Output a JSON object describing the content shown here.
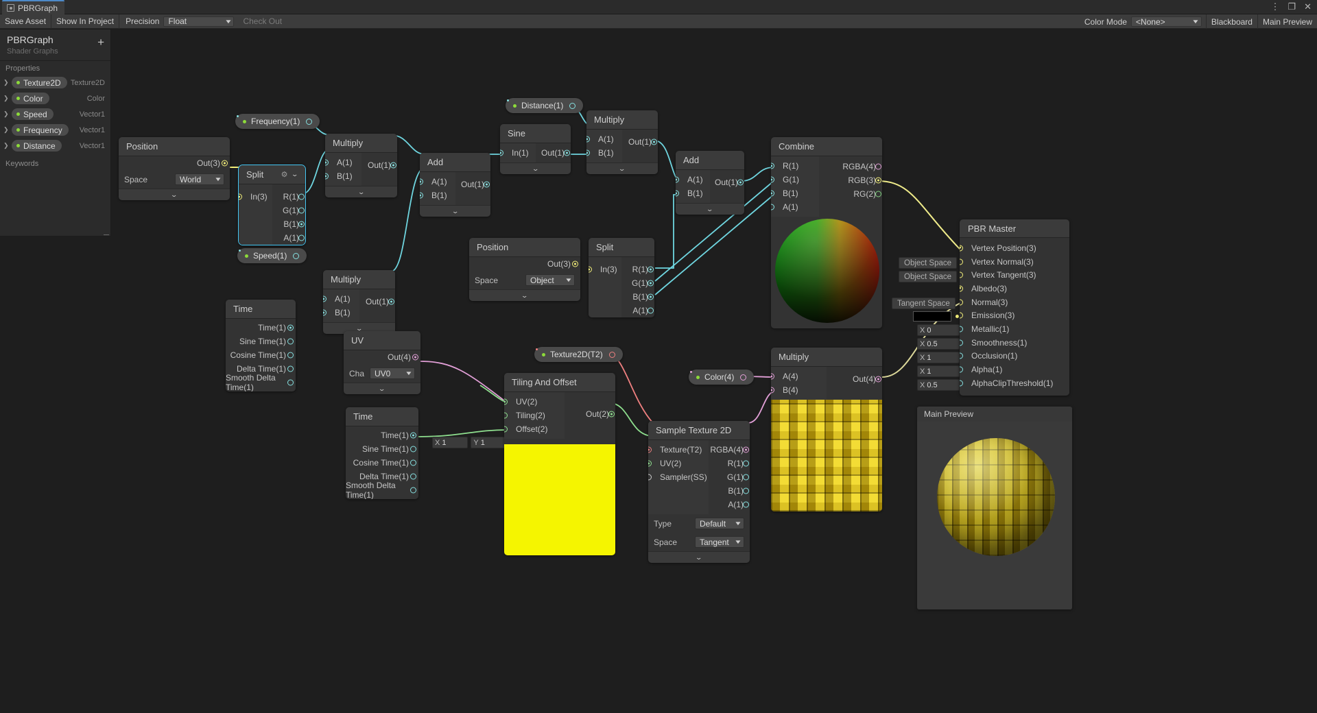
{
  "window": {
    "tab_title": "PBRGraph",
    "controls": [
      "⋮",
      "❐",
      "✕"
    ]
  },
  "toolbar": {
    "save_asset": "Save Asset",
    "show_in_project": "Show In Project",
    "precision_label": "Precision",
    "precision_value": "Float",
    "check_out": "Check Out",
    "color_mode_label": "Color Mode",
    "color_mode_value": "<None>",
    "blackboard": "Blackboard",
    "main_preview": "Main Preview"
  },
  "blackboard": {
    "title": "PBRGraph",
    "subtitle": "Shader Graphs",
    "properties_header": "Properties",
    "keywords_header": "Keywords",
    "add_label": "+",
    "properties": [
      {
        "name": "Texture2D",
        "type": "Texture2D"
      },
      {
        "name": "Color",
        "type": "Color"
      },
      {
        "name": "Speed",
        "type": "Vector1"
      },
      {
        "name": "Frequency",
        "type": "Vector1"
      },
      {
        "name": "Distance",
        "type": "Vector1"
      }
    ]
  },
  "tokens": {
    "frequency": "Frequency(1)",
    "distance": "Distance(1)",
    "speed": "Speed(1)",
    "texture2d": "Texture2D(T2)",
    "color": "Color(4)"
  },
  "nodes": {
    "position_world": {
      "title": "Position",
      "out": "Out(3)",
      "space_label": "Space",
      "space_value": "World"
    },
    "split_top": {
      "title": "Split",
      "in": "In(3)",
      "outputs": [
        "R(1)",
        "G(1)",
        "B(1)",
        "A(1)"
      ]
    },
    "multiply_1": {
      "title": "Multiply",
      "a": "A(1)",
      "b": "B(1)",
      "out": "Out(1)"
    },
    "add_1": {
      "title": "Add",
      "a": "A(1)",
      "b": "B(1)",
      "out": "Out(1)"
    },
    "sine": {
      "title": "Sine",
      "in": "In(1)",
      "out": "Out(1)"
    },
    "multiply_2": {
      "title": "Multiply",
      "a": "A(1)",
      "b": "B(1)",
      "out": "Out(1)"
    },
    "add_2": {
      "title": "Add",
      "a": "A(1)",
      "b": "B(1)",
      "out": "Out(1)"
    },
    "multiply_3": {
      "title": "Multiply",
      "a": "A(1)",
      "b": "B(1)",
      "out": "Out(1)"
    },
    "time_top": {
      "title": "Time",
      "outputs": [
        "Time(1)",
        "Sine Time(1)",
        "Cosine Time(1)",
        "Delta Time(1)",
        "Smooth Delta Time(1)"
      ]
    },
    "position_object": {
      "title": "Position",
      "out": "Out(3)",
      "space_label": "Space",
      "space_value": "Object"
    },
    "split_bottom": {
      "title": "Split",
      "in": "In(3)",
      "outputs": [
        "R(1)",
        "G(1)",
        "B(1)",
        "A(1)"
      ]
    },
    "combine": {
      "title": "Combine",
      "inputs": [
        "R(1)",
        "G(1)",
        "B(1)",
        "A(1)"
      ],
      "outputs": [
        "RGBA(4)",
        "RGB(3)",
        "RG(2)"
      ]
    },
    "uv": {
      "title": "UV",
      "out": "Out(4)",
      "channel_label": "Channel",
      "channel_value": "UV0"
    },
    "time_bottom": {
      "title": "Time",
      "outputs": [
        "Time(1)",
        "Sine Time(1)",
        "Cosine Time(1)",
        "Delta Time(1)",
        "Smooth Delta Time(1)"
      ]
    },
    "tiling_offset": {
      "title": "Tiling And Offset",
      "inputs": [
        "UV(2)",
        "Tiling(2)",
        "Offset(2)"
      ],
      "out": "Out(2)",
      "tiling_x_label": "X",
      "tiling_x": "1",
      "tiling_y_label": "Y",
      "tiling_y": "1"
    },
    "sample_texture": {
      "title": "Sample Texture 2D",
      "inputs": [
        "Texture(T2)",
        "UV(2)",
        "Sampler(SS)"
      ],
      "outputs": [
        "RGBA(4)",
        "R(1)",
        "G(1)",
        "B(1)",
        "A(1)"
      ],
      "type_label": "Type",
      "type_value": "Default",
      "space_label": "Space",
      "space_value": "Tangent"
    },
    "multiply_4": {
      "title": "Multiply",
      "a": "A(4)",
      "b": "B(4)",
      "out": "Out(4)"
    }
  },
  "master": {
    "title": "PBR Master",
    "slots": [
      {
        "label": "Vertex Position(3)",
        "connected": true,
        "default": null
      },
      {
        "label": "Vertex Normal(3)",
        "connected": false,
        "default": "Object Space"
      },
      {
        "label": "Vertex Tangent(3)",
        "connected": false,
        "default": "Object Space"
      },
      {
        "label": "Albedo(3)",
        "connected": true,
        "default": null
      },
      {
        "label": "Normal(3)",
        "connected": false,
        "default": "Tangent Space"
      },
      {
        "label": "Emission(3)",
        "connected": false,
        "default": "swatch"
      },
      {
        "label": "Metallic(1)",
        "connected": false,
        "default": "0",
        "axis": "X"
      },
      {
        "label": "Smoothness(1)",
        "connected": false,
        "default": "0.5",
        "axis": "X"
      },
      {
        "label": "Occlusion(1)",
        "connected": false,
        "default": "1",
        "axis": "X"
      },
      {
        "label": "Alpha(1)",
        "connected": false,
        "default": "1",
        "axis": "X"
      },
      {
        "label": "AlphaClipThreshold(1)",
        "connected": false,
        "default": "0.5",
        "axis": "X"
      }
    ]
  },
  "main_preview": {
    "title": "Main Preview"
  },
  "colors": {
    "accent_blue": "#44c8f5",
    "wire_vector1": "#86e0e0",
    "wire_vector3": "#f4f07a",
    "wire_vector4": "#e3a0d8",
    "wire_vector2": "#8fe08f",
    "wire_texture": "#f08080",
    "property_dot": "#8ddb3a",
    "background": "#1e1e1e"
  }
}
